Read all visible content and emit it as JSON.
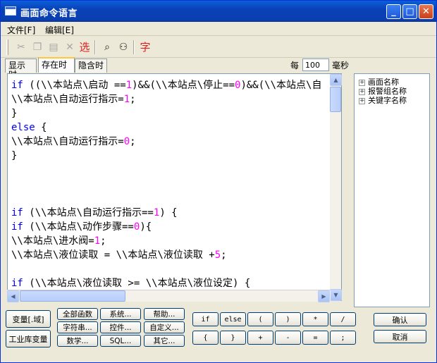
{
  "window": {
    "title": "画面命令语言"
  },
  "menu": {
    "file": "文件[F]",
    "edit": "编辑[E]"
  },
  "toolbar": {
    "select_label": "选",
    "font_label": "字"
  },
  "tabs": [
    {
      "label": "显示时"
    },
    {
      "label": "存在时"
    },
    {
      "label": "隐含时"
    }
  ],
  "interval": {
    "prefix": "每",
    "value": "100",
    "unit": "毫秒"
  },
  "tree": {
    "items": [
      "画面名称",
      "报警组名称",
      "关键字名称"
    ]
  },
  "buttons": {
    "var_field": "变量[.域]",
    "industry_var": "工业库变量",
    "all_funcs": "全部函数",
    "system": "系统...",
    "help": "帮助...",
    "string": "字符串...",
    "control": "控件...",
    "custom": "自定义...",
    "math": "数学...",
    "sql": "SQL...",
    "other": "其它...",
    "ok": "确认",
    "cancel": "取消"
  },
  "operators": [
    "if",
    "else",
    "(",
    ")",
    "*",
    "/",
    "{",
    "}",
    "+",
    "-",
    "=",
    ";"
  ],
  "code": [
    "if ((\\\\本站点\\启动 ==1)&&(\\\\本站点\\停止==0)&&(\\\\本站点\\自",
    "\\\\本站点\\自动运行指示=1;",
    "}",
    "else {",
    "\\\\本站点\\自动运行指示=0;",
    "}",
    "",
    "",
    "",
    "if (\\\\本站点\\自动运行指示==1) {",
    "if (\\\\本站点\\动作步骤==0){",
    "\\\\本站点\\进水阀=1;",
    "\\\\本站点\\液位读取 = \\\\本站点\\液位读取 +5;",
    "",
    "if (\\\\本站点\\液位读取 >= \\\\本站点\\液位设定) {"
  ]
}
